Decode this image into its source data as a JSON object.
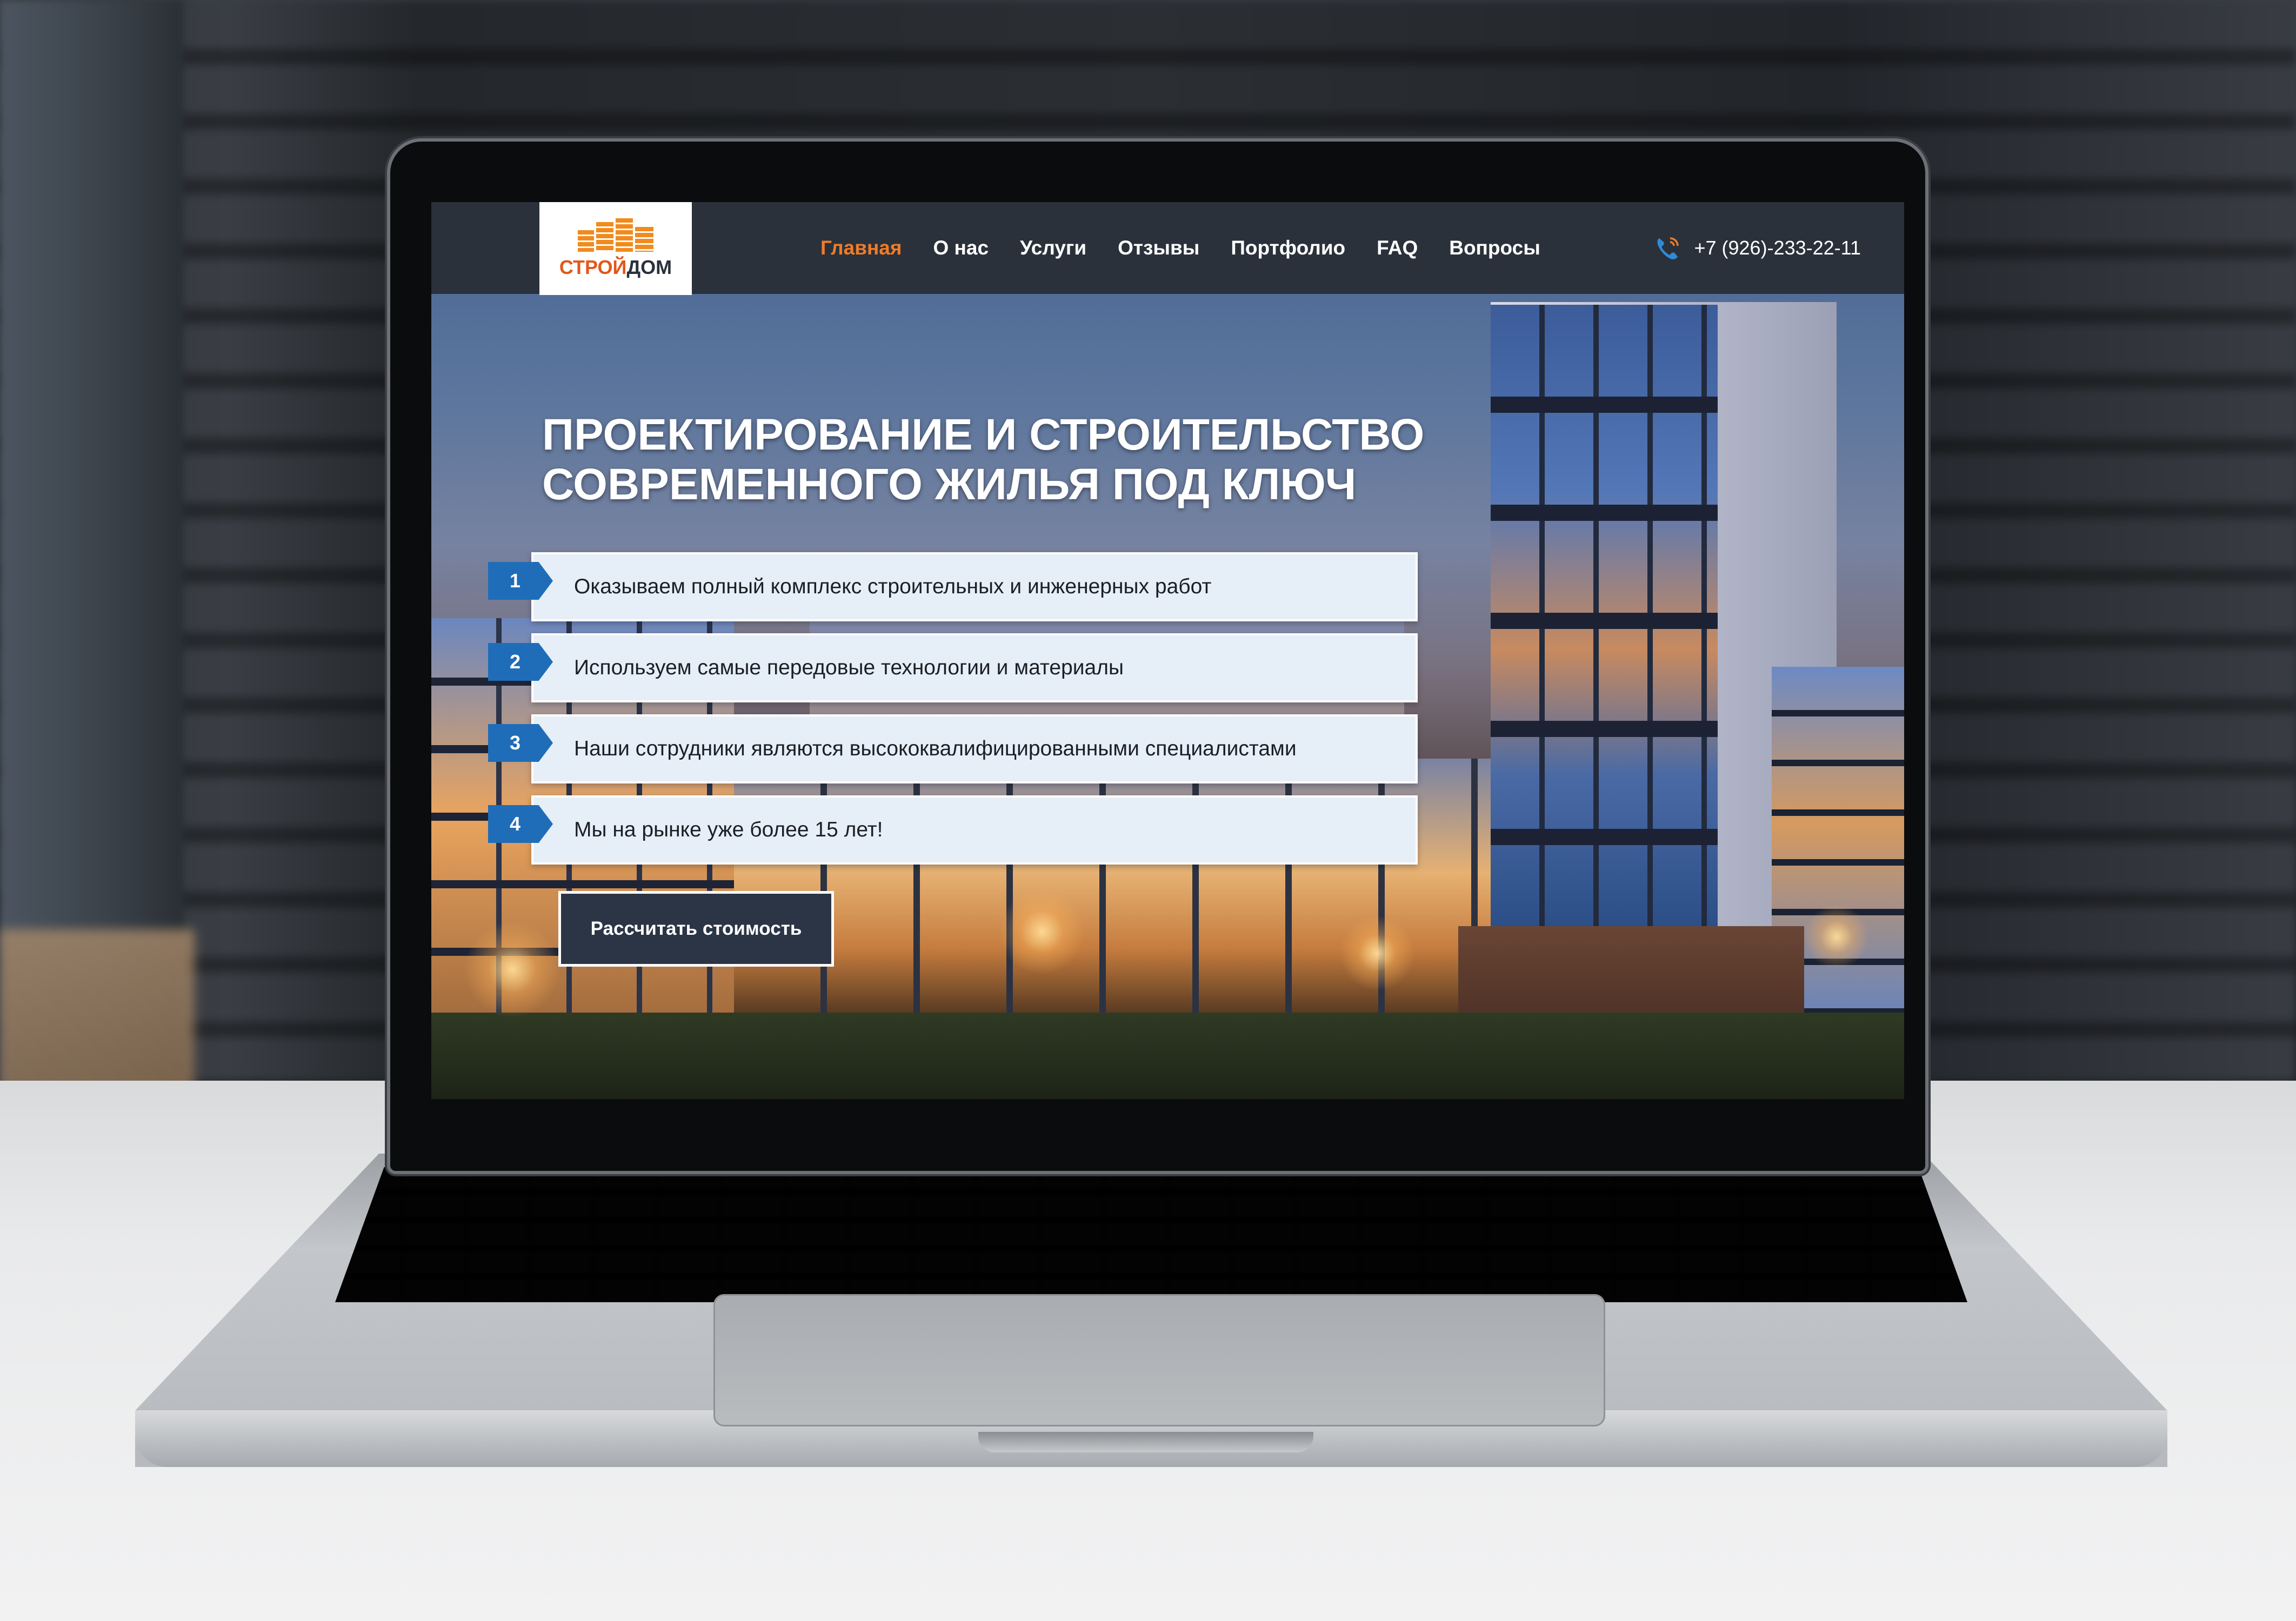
{
  "site": {
    "logo": {
      "part1": "СТРОЙ",
      "part2": "ДОМ"
    },
    "nav": [
      {
        "label": "Главная",
        "active": true
      },
      {
        "label": "О нас"
      },
      {
        "label": "Услуги"
      },
      {
        "label": "Отзывы"
      },
      {
        "label": "Портфолио"
      },
      {
        "label": "FAQ"
      },
      {
        "label": "Вопросы"
      }
    ],
    "phone": "+7 (926)-233-22-11",
    "hero": {
      "title_line1": "ПРОЕКТИРОВАНИЕ И СТРОИТЕЛЬСТВО",
      "title_line2": "СОВРЕМЕННОГО ЖИЛЬЯ ПОД КЛЮЧ",
      "features": [
        {
          "num": "1",
          "text": "Оказываем полный комплекс строительных и инженерных работ"
        },
        {
          "num": "2",
          "text": "Используем самые передовые технологии и материалы"
        },
        {
          "num": "3",
          "text": "Наши сотрудники являются высококвалифицированными специалистами"
        },
        {
          "num": "4",
          "text": "Мы на рынке уже более 15 лет!"
        }
      ],
      "cta_label": "Рассчитать стоимость"
    },
    "colors": {
      "accent": "#f07c28",
      "header_bg": "#2a313b",
      "badge_blue": "#1f6db8"
    },
    "icons": {
      "phone": "phone-icon"
    }
  }
}
